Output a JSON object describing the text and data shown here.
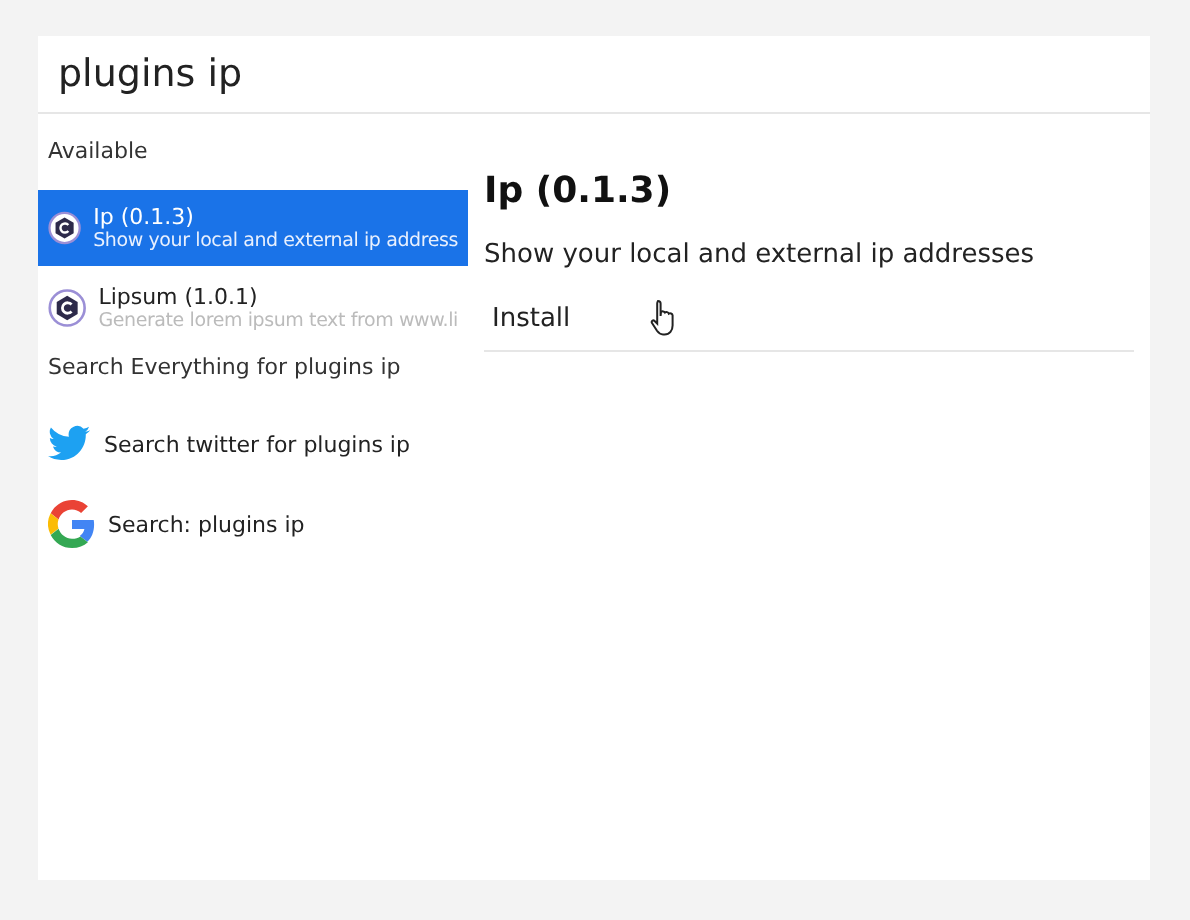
{
  "search": {
    "value": "plugins ip"
  },
  "sections": [
    {
      "title": "Available",
      "items": [
        {
          "kind": "plugin",
          "title": "Ip (0.1.3)",
          "subtitle": "Show your local and external ip address",
          "selected": true
        },
        {
          "kind": "plugin",
          "title": "Lipsum (1.0.1)",
          "subtitle": "Generate lorem ipsum text from www.li",
          "selected": false
        }
      ]
    },
    {
      "title": "Search Everything for plugins ip",
      "items": [
        {
          "kind": "twitter",
          "title": "Search twitter for plugins ip",
          "selected": false
        },
        {
          "kind": "google",
          "title": "Search: plugins ip",
          "selected": false
        }
      ]
    }
  ],
  "detail": {
    "title": "Ip (0.1.3)",
    "description": "Show your local and external ip addresses",
    "button": "Install"
  }
}
